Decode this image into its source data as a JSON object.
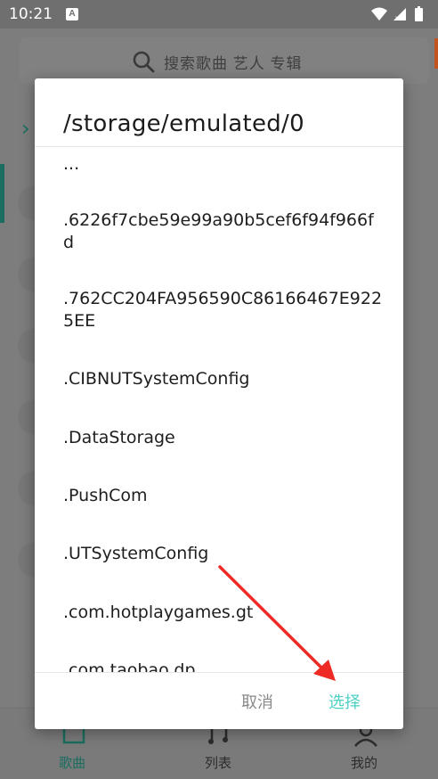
{
  "status_bar": {
    "time": "10:21",
    "notification_icon": "A"
  },
  "background": {
    "search_placeholder": "搜索歌曲 艺人 专辑",
    "nav": {
      "songs_label": "歌曲",
      "list_label": "列表",
      "mine_label": "我的"
    }
  },
  "dialog": {
    "title": "/storage/emulated/0",
    "items": [
      "...",
      ".6226f7cbe59e99a90b5cef6f94f966fd",
      ".762CC204FA956590C86166467E9225EE",
      ".CIBNUTSystemConfig",
      ".DataStorage",
      ".PushCom",
      ".UTSystemConfig",
      ".com.hotplaygames.gt",
      ".com.taobao.dp"
    ],
    "cancel_label": "取消",
    "select_label": "选择"
  },
  "colors": {
    "accent": "#4dd0c4",
    "brand_teal": "#1b6e5f",
    "annotation_arrow": "#ee2a24"
  }
}
